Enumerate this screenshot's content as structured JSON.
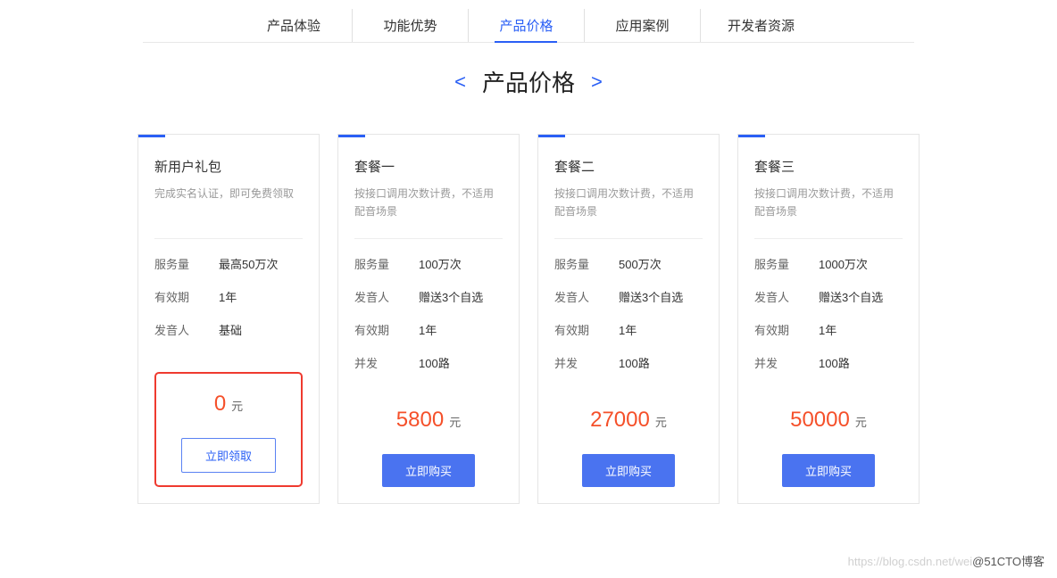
{
  "nav": {
    "tabs": [
      {
        "label": "产品体验",
        "active": false
      },
      {
        "label": "功能优势",
        "active": false
      },
      {
        "label": "产品价格",
        "active": true
      },
      {
        "label": "应用案例",
        "active": false
      },
      {
        "label": "开发者资源",
        "active": false
      }
    ]
  },
  "heading": "产品价格",
  "price_unit": "元",
  "cards": [
    {
      "title": "新用户礼包",
      "subtitle": "完成实名认证，即可免费领取",
      "specs": [
        {
          "label": "服务量",
          "value": "最高50万次"
        },
        {
          "label": "有效期",
          "value": "1年"
        },
        {
          "label": "发音人",
          "value": "基础"
        }
      ],
      "price": "0",
      "button": "立即领取",
      "button_style": "outline",
      "highlighted": true
    },
    {
      "title": "套餐一",
      "subtitle": "按接口调用次数计费，不适用配音场景",
      "specs": [
        {
          "label": "服务量",
          "value": "100万次"
        },
        {
          "label": "发音人",
          "value": "赠送3个自选"
        },
        {
          "label": "有效期",
          "value": "1年"
        },
        {
          "label": "并发",
          "value": "100路"
        }
      ],
      "price": "5800",
      "button": "立即购买",
      "button_style": "primary",
      "highlighted": false
    },
    {
      "title": "套餐二",
      "subtitle": "按接口调用次数计费，不适用配音场景",
      "specs": [
        {
          "label": "服务量",
          "value": "500万次"
        },
        {
          "label": "发音人",
          "value": "赠送3个自选"
        },
        {
          "label": "有效期",
          "value": "1年"
        },
        {
          "label": "并发",
          "value": "100路"
        }
      ],
      "price": "27000",
      "button": "立即购买",
      "button_style": "primary",
      "highlighted": false
    },
    {
      "title": "套餐三",
      "subtitle": "按接口调用次数计费，不适用配音场景",
      "specs": [
        {
          "label": "服务量",
          "value": "1000万次"
        },
        {
          "label": "发音人",
          "value": "赠送3个自选"
        },
        {
          "label": "有效期",
          "value": "1年"
        },
        {
          "label": "并发",
          "value": "100路"
        }
      ],
      "price": "50000",
      "button": "立即购买",
      "button_style": "primary",
      "highlighted": false
    }
  ],
  "watermark": {
    "faint": "https://blog.csdn.net/wei",
    "dark": "@51CTO博客"
  }
}
